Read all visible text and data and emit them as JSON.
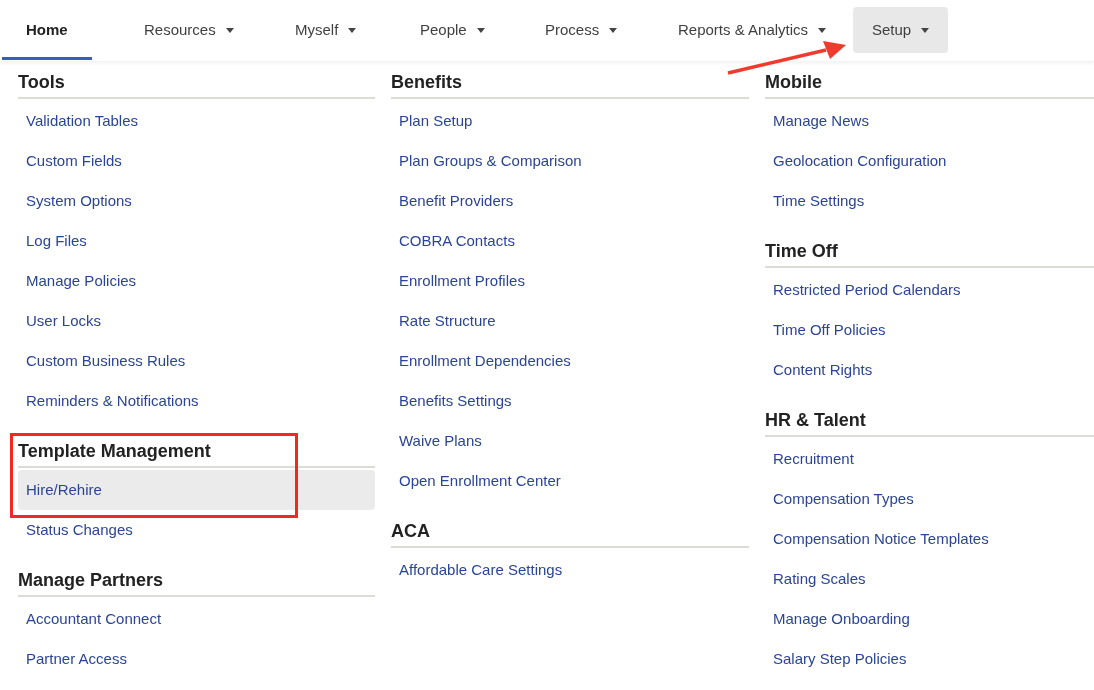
{
  "nav": {
    "tabs": [
      {
        "label": "Home",
        "selected": true,
        "open": false,
        "has_menu": false
      },
      {
        "label": "Resources",
        "selected": false,
        "open": false,
        "has_menu": true
      },
      {
        "label": "Myself",
        "selected": false,
        "open": false,
        "has_menu": true
      },
      {
        "label": "People",
        "selected": false,
        "open": false,
        "has_menu": true
      },
      {
        "label": "Process",
        "selected": false,
        "open": false,
        "has_menu": true
      },
      {
        "label": "Reports & Analytics",
        "selected": false,
        "open": false,
        "has_menu": true
      },
      {
        "label": "Setup",
        "selected": false,
        "open": true,
        "has_menu": true
      }
    ]
  },
  "menu": {
    "columns": [
      {
        "sections": [
          {
            "heading": "Tools",
            "items": [
              {
                "label": "Validation Tables",
                "hovered": false
              },
              {
                "label": "Custom Fields",
                "hovered": false
              },
              {
                "label": "System Options",
                "hovered": false
              },
              {
                "label": "Log Files",
                "hovered": false
              },
              {
                "label": "Manage Policies",
                "hovered": false
              },
              {
                "label": "User Locks",
                "hovered": false
              },
              {
                "label": "Custom Business Rules",
                "hovered": false
              },
              {
                "label": "Reminders & Notifications",
                "hovered": false
              }
            ]
          },
          {
            "heading": "Template Management",
            "items": [
              {
                "label": "Hire/Rehire",
                "hovered": true
              },
              {
                "label": "Status Changes",
                "hovered": false
              }
            ]
          },
          {
            "heading": "Manage Partners",
            "items": [
              {
                "label": "Accountant Connect",
                "hovered": false
              },
              {
                "label": "Partner Access",
                "hovered": false
              }
            ]
          }
        ]
      },
      {
        "sections": [
          {
            "heading": "Benefits",
            "items": [
              {
                "label": "Plan Setup",
                "hovered": false
              },
              {
                "label": "Plan Groups & Comparison",
                "hovered": false
              },
              {
                "label": "Benefit Providers",
                "hovered": false
              },
              {
                "label": "COBRA Contacts",
                "hovered": false
              },
              {
                "label": "Enrollment Profiles",
                "hovered": false
              },
              {
                "label": "Rate Structure",
                "hovered": false
              },
              {
                "label": "Enrollment Dependencies",
                "hovered": false
              },
              {
                "label": "Benefits Settings",
                "hovered": false
              },
              {
                "label": "Waive Plans",
                "hovered": false
              },
              {
                "label": "Open Enrollment Center",
                "hovered": false
              }
            ]
          },
          {
            "heading": "ACA",
            "items": [
              {
                "label": "Affordable Care Settings",
                "hovered": false
              }
            ]
          }
        ]
      },
      {
        "sections": [
          {
            "heading": "Mobile",
            "items": [
              {
                "label": "Manage News",
                "hovered": false
              },
              {
                "label": "Geolocation Configuration",
                "hovered": false
              },
              {
                "label": "Time Settings",
                "hovered": false
              }
            ]
          },
          {
            "heading": "Time Off",
            "items": [
              {
                "label": "Restricted Period Calendars",
                "hovered": false
              },
              {
                "label": "Time Off Policies",
                "hovered": false
              },
              {
                "label": "Content Rights",
                "hovered": false
              }
            ]
          },
          {
            "heading": "HR & Talent",
            "items": [
              {
                "label": "Recruitment",
                "hovered": false
              },
              {
                "label": "Compensation Types",
                "hovered": false
              },
              {
                "label": "Compensation Notice Templates",
                "hovered": false
              },
              {
                "label": "Rating Scales",
                "hovered": false
              },
              {
                "label": "Manage Onboarding",
                "hovered": false
              },
              {
                "label": "Salary Step Policies",
                "hovered": false
              }
            ]
          }
        ]
      }
    ]
  }
}
